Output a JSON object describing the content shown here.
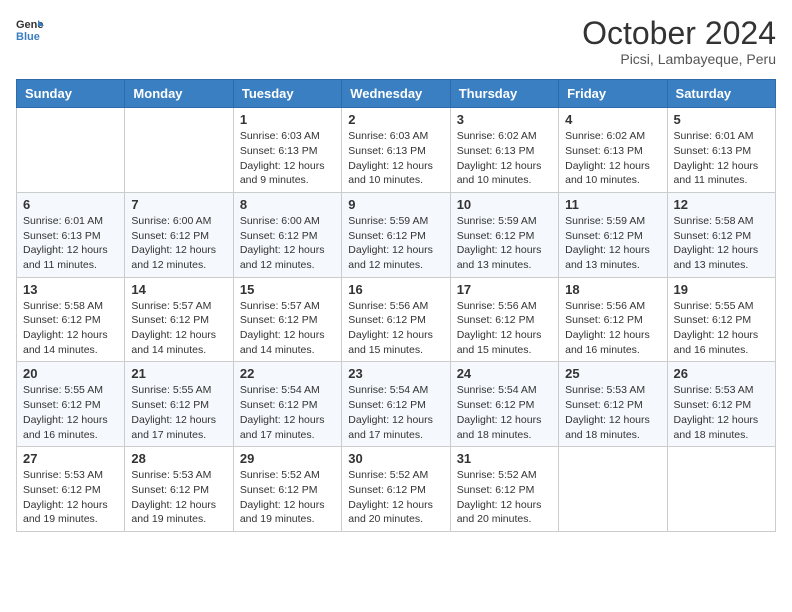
{
  "logo": {
    "general": "General",
    "blue": "Blue"
  },
  "title": "October 2024",
  "location": "Picsi, Lambayeque, Peru",
  "days_of_week": [
    "Sunday",
    "Monday",
    "Tuesday",
    "Wednesday",
    "Thursday",
    "Friday",
    "Saturday"
  ],
  "weeks": [
    [
      {
        "day": "",
        "sunrise": "",
        "sunset": "",
        "daylight": ""
      },
      {
        "day": "",
        "sunrise": "",
        "sunset": "",
        "daylight": ""
      },
      {
        "day": "1",
        "sunrise": "Sunrise: 6:03 AM",
        "sunset": "Sunset: 6:13 PM",
        "daylight": "Daylight: 12 hours and 9 minutes."
      },
      {
        "day": "2",
        "sunrise": "Sunrise: 6:03 AM",
        "sunset": "Sunset: 6:13 PM",
        "daylight": "Daylight: 12 hours and 10 minutes."
      },
      {
        "day": "3",
        "sunrise": "Sunrise: 6:02 AM",
        "sunset": "Sunset: 6:13 PM",
        "daylight": "Daylight: 12 hours and 10 minutes."
      },
      {
        "day": "4",
        "sunrise": "Sunrise: 6:02 AM",
        "sunset": "Sunset: 6:13 PM",
        "daylight": "Daylight: 12 hours and 10 minutes."
      },
      {
        "day": "5",
        "sunrise": "Sunrise: 6:01 AM",
        "sunset": "Sunset: 6:13 PM",
        "daylight": "Daylight: 12 hours and 11 minutes."
      }
    ],
    [
      {
        "day": "6",
        "sunrise": "Sunrise: 6:01 AM",
        "sunset": "Sunset: 6:13 PM",
        "daylight": "Daylight: 12 hours and 11 minutes."
      },
      {
        "day": "7",
        "sunrise": "Sunrise: 6:00 AM",
        "sunset": "Sunset: 6:12 PM",
        "daylight": "Daylight: 12 hours and 12 minutes."
      },
      {
        "day": "8",
        "sunrise": "Sunrise: 6:00 AM",
        "sunset": "Sunset: 6:12 PM",
        "daylight": "Daylight: 12 hours and 12 minutes."
      },
      {
        "day": "9",
        "sunrise": "Sunrise: 5:59 AM",
        "sunset": "Sunset: 6:12 PM",
        "daylight": "Daylight: 12 hours and 12 minutes."
      },
      {
        "day": "10",
        "sunrise": "Sunrise: 5:59 AM",
        "sunset": "Sunset: 6:12 PM",
        "daylight": "Daylight: 12 hours and 13 minutes."
      },
      {
        "day": "11",
        "sunrise": "Sunrise: 5:59 AM",
        "sunset": "Sunset: 6:12 PM",
        "daylight": "Daylight: 12 hours and 13 minutes."
      },
      {
        "day": "12",
        "sunrise": "Sunrise: 5:58 AM",
        "sunset": "Sunset: 6:12 PM",
        "daylight": "Daylight: 12 hours and 13 minutes."
      }
    ],
    [
      {
        "day": "13",
        "sunrise": "Sunrise: 5:58 AM",
        "sunset": "Sunset: 6:12 PM",
        "daylight": "Daylight: 12 hours and 14 minutes."
      },
      {
        "day": "14",
        "sunrise": "Sunrise: 5:57 AM",
        "sunset": "Sunset: 6:12 PM",
        "daylight": "Daylight: 12 hours and 14 minutes."
      },
      {
        "day": "15",
        "sunrise": "Sunrise: 5:57 AM",
        "sunset": "Sunset: 6:12 PM",
        "daylight": "Daylight: 12 hours and 14 minutes."
      },
      {
        "day": "16",
        "sunrise": "Sunrise: 5:56 AM",
        "sunset": "Sunset: 6:12 PM",
        "daylight": "Daylight: 12 hours and 15 minutes."
      },
      {
        "day": "17",
        "sunrise": "Sunrise: 5:56 AM",
        "sunset": "Sunset: 6:12 PM",
        "daylight": "Daylight: 12 hours and 15 minutes."
      },
      {
        "day": "18",
        "sunrise": "Sunrise: 5:56 AM",
        "sunset": "Sunset: 6:12 PM",
        "daylight": "Daylight: 12 hours and 16 minutes."
      },
      {
        "day": "19",
        "sunrise": "Sunrise: 5:55 AM",
        "sunset": "Sunset: 6:12 PM",
        "daylight": "Daylight: 12 hours and 16 minutes."
      }
    ],
    [
      {
        "day": "20",
        "sunrise": "Sunrise: 5:55 AM",
        "sunset": "Sunset: 6:12 PM",
        "daylight": "Daylight: 12 hours and 16 minutes."
      },
      {
        "day": "21",
        "sunrise": "Sunrise: 5:55 AM",
        "sunset": "Sunset: 6:12 PM",
        "daylight": "Daylight: 12 hours and 17 minutes."
      },
      {
        "day": "22",
        "sunrise": "Sunrise: 5:54 AM",
        "sunset": "Sunset: 6:12 PM",
        "daylight": "Daylight: 12 hours and 17 minutes."
      },
      {
        "day": "23",
        "sunrise": "Sunrise: 5:54 AM",
        "sunset": "Sunset: 6:12 PM",
        "daylight": "Daylight: 12 hours and 17 minutes."
      },
      {
        "day": "24",
        "sunrise": "Sunrise: 5:54 AM",
        "sunset": "Sunset: 6:12 PM",
        "daylight": "Daylight: 12 hours and 18 minutes."
      },
      {
        "day": "25",
        "sunrise": "Sunrise: 5:53 AM",
        "sunset": "Sunset: 6:12 PM",
        "daylight": "Daylight: 12 hours and 18 minutes."
      },
      {
        "day": "26",
        "sunrise": "Sunrise: 5:53 AM",
        "sunset": "Sunset: 6:12 PM",
        "daylight": "Daylight: 12 hours and 18 minutes."
      }
    ],
    [
      {
        "day": "27",
        "sunrise": "Sunrise: 5:53 AM",
        "sunset": "Sunset: 6:12 PM",
        "daylight": "Daylight: 12 hours and 19 minutes."
      },
      {
        "day": "28",
        "sunrise": "Sunrise: 5:53 AM",
        "sunset": "Sunset: 6:12 PM",
        "daylight": "Daylight: 12 hours and 19 minutes."
      },
      {
        "day": "29",
        "sunrise": "Sunrise: 5:52 AM",
        "sunset": "Sunset: 6:12 PM",
        "daylight": "Daylight: 12 hours and 19 minutes."
      },
      {
        "day": "30",
        "sunrise": "Sunrise: 5:52 AM",
        "sunset": "Sunset: 6:12 PM",
        "daylight": "Daylight: 12 hours and 20 minutes."
      },
      {
        "day": "31",
        "sunrise": "Sunrise: 5:52 AM",
        "sunset": "Sunset: 6:12 PM",
        "daylight": "Daylight: 12 hours and 20 minutes."
      },
      {
        "day": "",
        "sunrise": "",
        "sunset": "",
        "daylight": ""
      },
      {
        "day": "",
        "sunrise": "",
        "sunset": "",
        "daylight": ""
      }
    ]
  ]
}
